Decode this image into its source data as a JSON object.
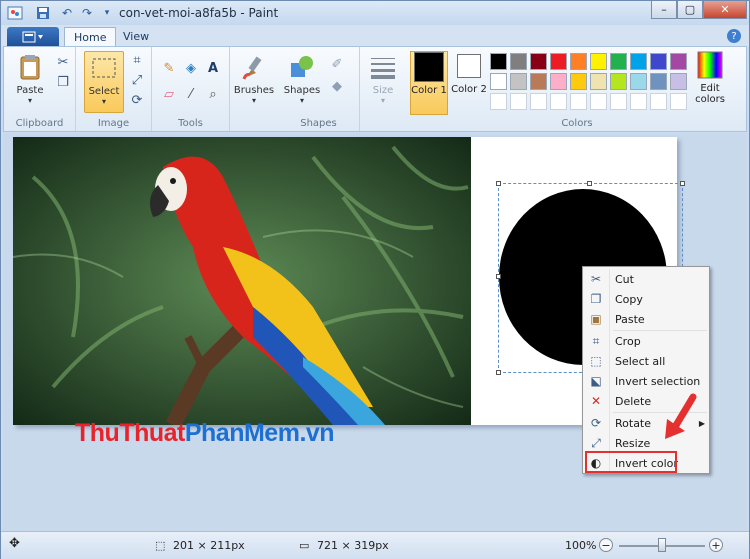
{
  "window": {
    "title": "con-vet-moi-a8fa5b - Paint",
    "min_label": "–",
    "max_label": "▢",
    "close_label": "✕"
  },
  "tabs": [
    {
      "label": "Home"
    },
    {
      "label": "View"
    }
  ],
  "ribbon": {
    "clipboard": {
      "paste_label": "Paste",
      "group_label": "Clipboard"
    },
    "image": {
      "select_label": "Select",
      "group_label": "Image"
    },
    "tools": {
      "group_label": "Tools",
      "text_tool": "A"
    },
    "brushes": {
      "label": "Brushes"
    },
    "shapes": {
      "label": "Shapes",
      "group_label": "Shapes"
    },
    "size": {
      "label": "Size"
    },
    "colors": {
      "color1_label": "Color 1",
      "color2_label": "Color 2",
      "group_label": "Colors",
      "edit_label": "Edit colors",
      "color1": "#000000",
      "color2": "#ffffff",
      "palette_row1": [
        "#000000",
        "#7f7f7f",
        "#880015",
        "#ed1c24",
        "#ff7f27",
        "#fff200",
        "#22b14c",
        "#00a2e8",
        "#3f48cc",
        "#a349a4"
      ],
      "palette_row2": [
        "#ffffff",
        "#c3c3c3",
        "#b97a57",
        "#ffaec9",
        "#ffc90e",
        "#efe4b0",
        "#b5e61d",
        "#99d9ea",
        "#7092be",
        "#c8bfe7"
      ]
    }
  },
  "watermark": {
    "part1": "ThuThuat",
    "part2": "PhanMem",
    "part3": ".vn",
    "color1": "#e8232b",
    "color2": "#1d6fd1"
  },
  "context_menu": {
    "items": [
      {
        "label": "Cut",
        "icon": "scissors-icon"
      },
      {
        "label": "Copy",
        "icon": "copy-icon"
      },
      {
        "label": "Paste",
        "icon": "paste-icon"
      },
      {
        "label": "Crop",
        "icon": "crop-icon"
      },
      {
        "label": "Select all",
        "icon": "select-all-icon"
      },
      {
        "label": "Invert selection",
        "icon": "invert-selection-icon"
      },
      {
        "label": "Delete",
        "icon": "delete-icon"
      },
      {
        "label": "Rotate",
        "icon": "rotate-icon"
      },
      {
        "label": "Resize",
        "icon": "resize-icon"
      },
      {
        "label": "Invert color",
        "icon": "invert-color-icon"
      }
    ]
  },
  "status": {
    "selection_size": "201 × 211px",
    "image_size": "721 × 319px",
    "zoom": "100%",
    "zoom_out": "−",
    "zoom_in": "+",
    "zoom_level": 1.0
  }
}
